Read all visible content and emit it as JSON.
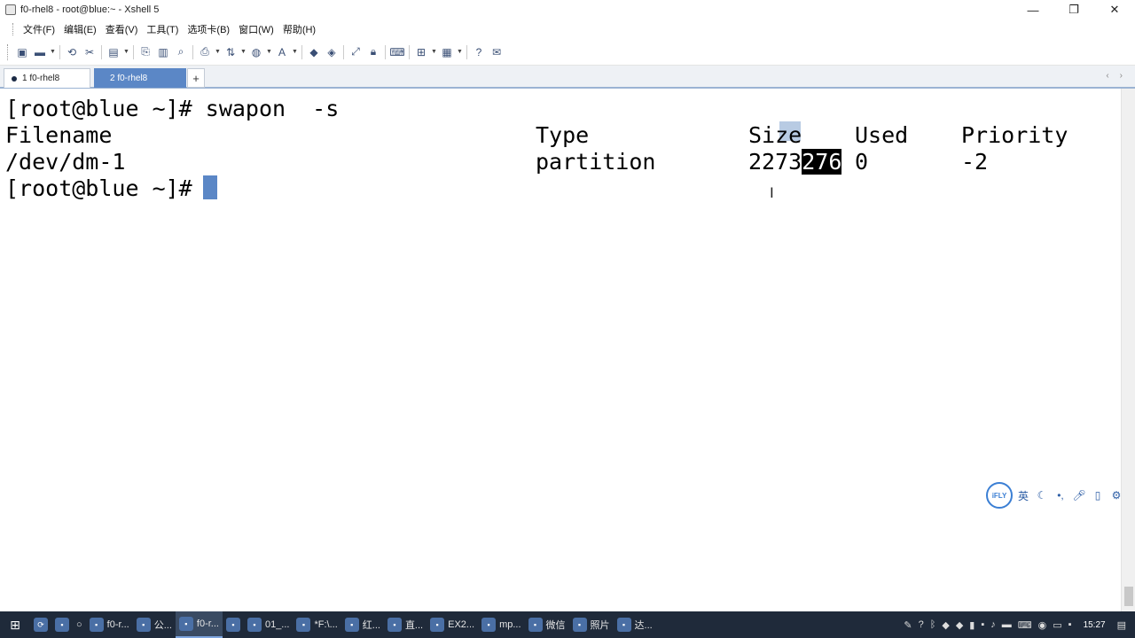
{
  "window": {
    "title": "f0-rhel8 - root@blue:~ - Xshell 5",
    "controls": [
      "—",
      "❐",
      "✕"
    ]
  },
  "menu": [
    "文件(F)",
    "编辑(E)",
    "查看(V)",
    "工具(T)",
    "选项卡(B)",
    "窗口(W)",
    "帮助(H)"
  ],
  "toolbar_icons": [
    "new-session-icon",
    "open-folder-icon",
    "reconnect-icon",
    "disconnect-icon",
    "properties-icon",
    "copy-icon",
    "paste-icon",
    "find-icon",
    "print-icon",
    "transfer-icon",
    "globe-icon",
    "font-icon",
    "xftp-icon",
    "xmanager-icon",
    "fullscreen-icon",
    "lock-icon",
    "keyboard-icon",
    "compose-icon",
    "layout-icon",
    "help-icon",
    "chat-icon"
  ],
  "tabs": [
    {
      "label": "1 f0-rhel8"
    },
    {
      "label": "2 f0-rhel8"
    }
  ],
  "tab_add": "+",
  "tab_nav": [
    "‹",
    "›"
  ],
  "terminal": {
    "line1": "[root@blue ~]# swapon  -s",
    "header": {
      "filename": "Filename",
      "type": "Type",
      "size": "Size",
      "used": "Used",
      "priority": "Priority"
    },
    "row": {
      "filename": "/dev/dm-1",
      "type": "partition",
      "size_a": "2273",
      "size_b": "276",
      "used": "0",
      "priority": "-2"
    },
    "prompt": "[root@blue ~]# "
  },
  "ime": {
    "label": "iFLY",
    "lang": "英"
  },
  "taskbar": {
    "items": [
      "f0-r...",
      "公...",
      "f0-r...",
      "01_...",
      "*F:\\...",
      "红...",
      "直...",
      "EX2...",
      "mp...",
      "微信",
      "照片",
      "达..."
    ],
    "clock": "15:27"
  }
}
